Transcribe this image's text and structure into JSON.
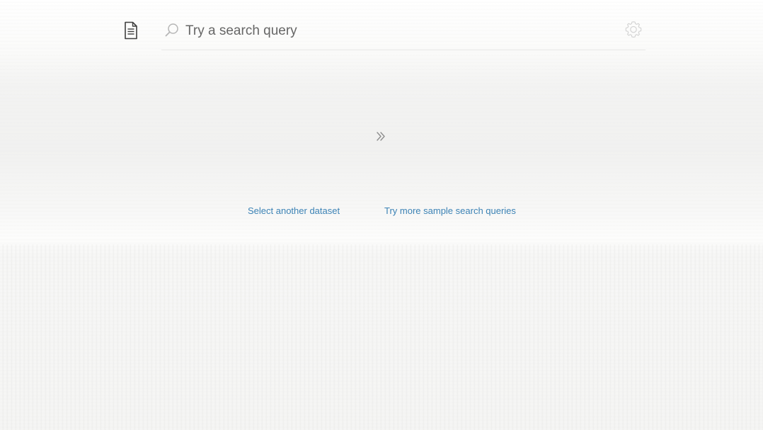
{
  "search": {
    "placeholder": "Try a search query",
    "value": ""
  },
  "links": {
    "select_dataset": "Select another dataset",
    "sample_queries": "Try more sample search queries"
  },
  "icons": {
    "document": "document-icon",
    "search": "search-icon",
    "settings": "gear-icon",
    "expand": "double-chevron-right-icon"
  },
  "colors": {
    "link": "#3b82b5",
    "text": "#666666",
    "icon": "#555555",
    "background": "#f7f7f6"
  }
}
